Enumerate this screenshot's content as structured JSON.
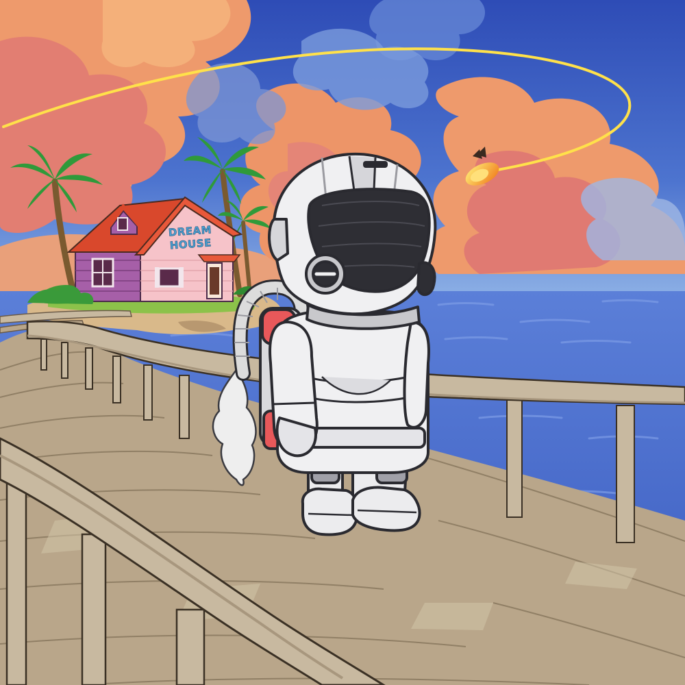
{
  "house": {
    "sign_line1": "DREAM",
    "sign_line2": "HOUSE"
  },
  "colors": {
    "sky_top": "#2f4fb8",
    "sky_horizon": "#7aa6e0",
    "cloud_orange": "#f0a06a",
    "cloud_pink": "#e07a72",
    "sea": "#3f63c4",
    "sea_light": "#6e8fe0",
    "house_wall": "#f6c3c9",
    "house_roof": "#d9482c",
    "house_side": "#a85fa8",
    "palm_leaf": "#2f9a3a",
    "pier_wood": "#b9a68a",
    "pier_rail": "#c8b9a0",
    "astronaut_suit": "#f2f2f2",
    "astronaut_visor": "#2e2e34",
    "jetpack_red": "#e8585a",
    "trail_yellow": "#ffe14a",
    "fireball": "#ffb020"
  },
  "icons": [
    "astronaut-figure",
    "jetpack-icon",
    "palm-tree-icon",
    "fireball-icon",
    "house-icon"
  ]
}
